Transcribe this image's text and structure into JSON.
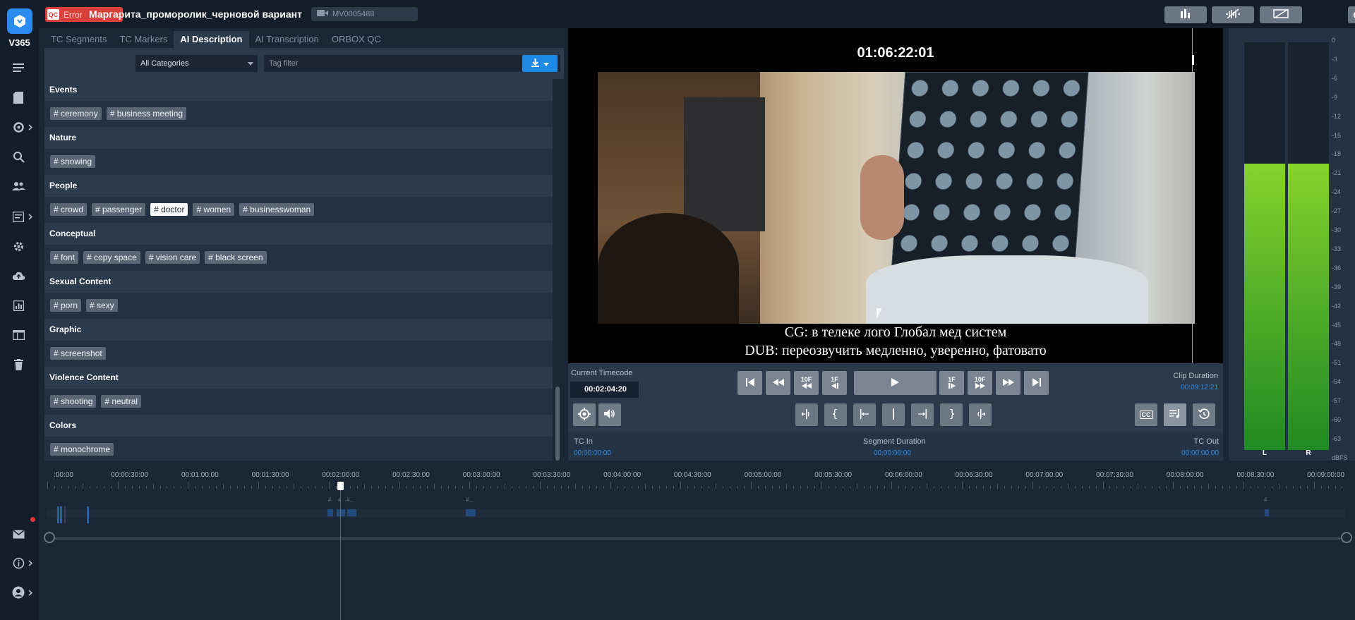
{
  "sidebar": {
    "logo_text": "V365",
    "items": [
      {
        "icon": "menu-icon"
      },
      {
        "icon": "library-icon"
      },
      {
        "icon": "dashboard-icon",
        "has_submenu": true
      },
      {
        "icon": "search-icon"
      },
      {
        "icon": "users-icon"
      },
      {
        "icon": "tasks-icon",
        "has_submenu": true
      },
      {
        "icon": "settings-icon"
      },
      {
        "icon": "upload-icon"
      },
      {
        "icon": "reports-icon"
      },
      {
        "icon": "schedule-icon"
      },
      {
        "icon": "trash-icon"
      }
    ],
    "bottom": [
      {
        "icon": "mail-icon"
      },
      {
        "icon": "info-icon"
      },
      {
        "icon": "account-icon"
      }
    ]
  },
  "header": {
    "qc_label": "QC",
    "qc_status": "Error",
    "title": "Маргарита_проморолик_черновой вариант",
    "asset_id": "MV0005488",
    "close_label": "Close"
  },
  "tabs": [
    {
      "label": "TC Segments",
      "active": false
    },
    {
      "label": "TC Markers",
      "active": false
    },
    {
      "label": "AI Description",
      "active": true
    },
    {
      "label": "AI Transcription",
      "active": false
    },
    {
      "label": "ORBOX QC",
      "active": false
    }
  ],
  "filters": {
    "category": "All Categories",
    "tag_placeholder": "Tag filter"
  },
  "categories": [
    {
      "name": "Events",
      "tags": [
        "# ceremony",
        "# business meeting"
      ]
    },
    {
      "name": "Nature",
      "tags": [
        "# snowing"
      ]
    },
    {
      "name": "People",
      "tags": [
        "# crowd",
        "# passenger",
        "# doctor",
        "# women",
        "# businesswoman"
      ],
      "selected": "# doctor"
    },
    {
      "name": "Conceptual",
      "tags": [
        "# font",
        "# copy space",
        "# vision care",
        "# black screen"
      ]
    },
    {
      "name": "Sexual Content",
      "tags": [
        "# porn",
        "# sexy"
      ]
    },
    {
      "name": "Graphic",
      "tags": [
        "# screenshot"
      ]
    },
    {
      "name": "Violence Content",
      "tags": [
        "# shooting",
        "# neutral"
      ]
    },
    {
      "name": "Colors",
      "tags": [
        "# monochrome"
      ]
    }
  ],
  "player": {
    "overlay_timecode": "01:06:22:01",
    "subtitle_line1": "CG: в телеке лого Глобал мед систем",
    "subtitle_line2": "DUB: переозвучить медленно, уверенно, фатовато",
    "current_timecode_label": "Current Timecode",
    "current_timecode": "00:02:04:20",
    "clip_duration_label": "Clip Duration",
    "clip_duration": "00:09:12:21",
    "btn_10f": "10F",
    "btn_1f": "1F",
    "cc_label": "CC",
    "tc_in_label": "TC In",
    "tc_in": "00:00:00:00",
    "segment_duration_label": "Segment Duration",
    "segment_duration": "00:00:00:00",
    "tc_out_label": "TC Out",
    "tc_out": "00:00:00:00"
  },
  "meters": {
    "left_label": "L",
    "right_label": "R",
    "left_level_dbfs": -19.5,
    "right_level_dbfs": -19.5,
    "scale": [
      "0",
      "-3",
      "-6",
      "-9",
      "-12",
      "-15",
      "-18",
      "-21",
      "-24",
      "-27",
      "-30",
      "-33",
      "-36",
      "-39",
      "-42",
      "-45",
      "-48",
      "-51",
      "-54",
      "-57",
      "-60",
      "-63",
      "dBFS"
    ]
  },
  "timeline": {
    "labels": [
      ":00:00",
      "00:00:30:00",
      "00:01:00:00",
      "00:01:30:00",
      "00:02:00:00",
      "00:02:30:00",
      "00:03:00:00",
      "00:03:30:00",
      "00:04:00:00",
      "00:04:30:00",
      "00:05:00:00",
      "00:05:30:00",
      "00:06:00:00",
      "00:06:30:00",
      "00:07:00:00",
      "00:07:30:00",
      "00:08:00:00",
      "00:08:30:00",
      "00:09:00:00"
    ],
    "marker_glyphs": [
      "#",
      "#",
      "#...",
      "#...",
      "#"
    ],
    "colors": {
      "accent": "#2f8be6",
      "error": "#d9413a",
      "meter_green": "#5cb428"
    }
  }
}
